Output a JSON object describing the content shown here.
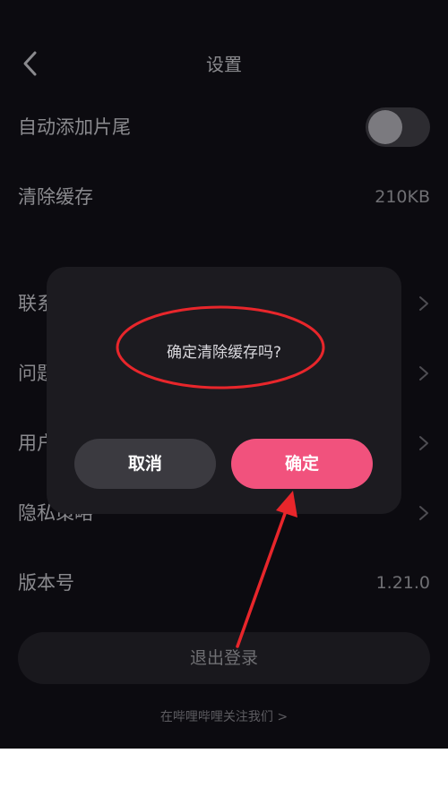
{
  "header": {
    "title": "设置"
  },
  "settings": {
    "auto_tail": {
      "label": "自动添加片尾",
      "toggle_on": false
    },
    "clear_cache": {
      "label": "清除缓存",
      "value": "210KB"
    },
    "contact": {
      "label": "联系"
    },
    "feedback": {
      "label": "问题"
    },
    "agreement": {
      "label": "用户"
    },
    "privacy": {
      "label": "隐私策略"
    },
    "version": {
      "label": "版本号",
      "value": "1.21.0"
    }
  },
  "logout": {
    "label": "退出登录"
  },
  "footer": {
    "follow_text": "在哔哩哔哩关注我们 >"
  },
  "dialog": {
    "message": "确定清除缓存吗?",
    "cancel_label": "取消",
    "confirm_label": "确定"
  },
  "colors": {
    "accent": "#f1527d",
    "annotation": "#e8262b",
    "background": "#0c0b10"
  }
}
